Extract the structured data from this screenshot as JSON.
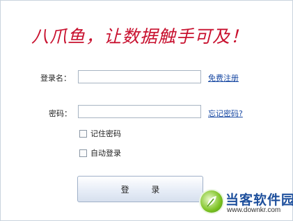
{
  "slogan": "八爪鱼，让数据触手可及！",
  "form": {
    "username_label": "登录名：",
    "username_value": "",
    "register_link": "免费注册",
    "password_label": "密码：",
    "password_value": "",
    "forgot_link": "忘记密码?",
    "remember_label": "记住密码",
    "remember_checked": false,
    "autologin_label": "自动登录",
    "autologin_checked": false,
    "login_button": "登 录"
  },
  "watermark": {
    "name": "当客软件园",
    "url": "www.downkr.com",
    "logo_icon": "leaf-logo-icon"
  },
  "colors": {
    "slogan": "#c8102e",
    "link": "#1a4aa3",
    "watermark_name": "#1d4f9c",
    "watermark_logo": "#7cc222"
  }
}
